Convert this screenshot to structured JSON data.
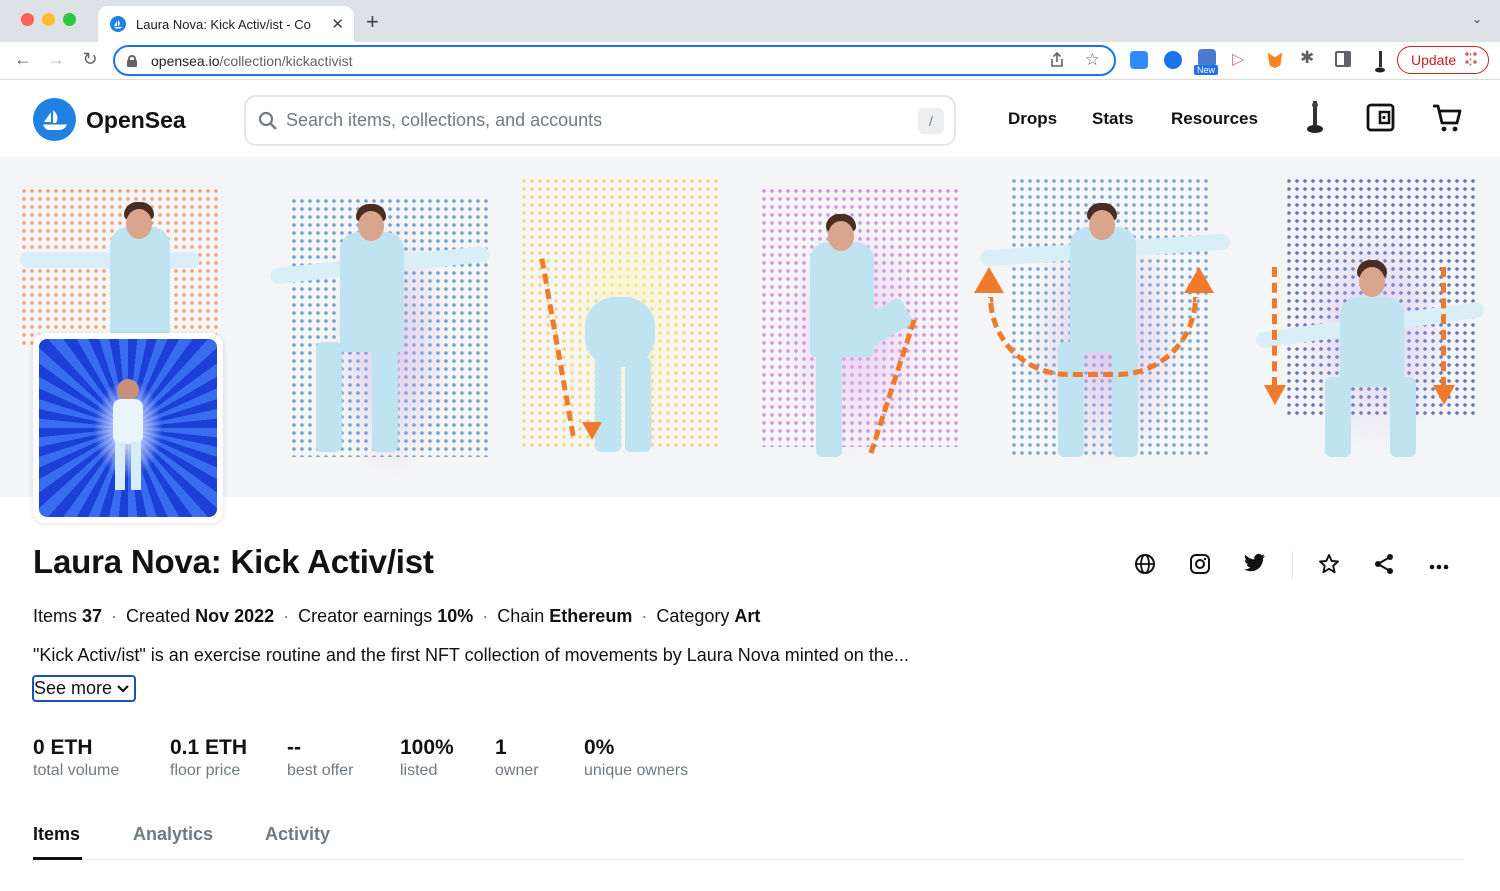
{
  "browser": {
    "tab_title": "Laura Nova: Kick Activ/ist - Co",
    "url_host": "opensea.io",
    "url_path": "/collection/kickactivist",
    "ext_new_badge": "New",
    "update_label": "Update"
  },
  "header": {
    "logo_text": "OpenSea",
    "search_placeholder": "Search items, collections, and accounts",
    "search_shortcut": "/",
    "nav": [
      "Drops",
      "Stats",
      "Resources"
    ]
  },
  "collection": {
    "title": "Laura Nova: Kick Activ/ist",
    "meta": {
      "items_label": "Items",
      "items_value": "37",
      "created_label": "Created",
      "created_value": "Nov 2022",
      "earnings_label": "Creator earnings",
      "earnings_value": "10%",
      "chain_label": "Chain",
      "chain_value": "Ethereum",
      "category_label": "Category",
      "category_value": "Art"
    },
    "description": "\"Kick Activ/ist\" is an exercise routine and the first NFT collection of movements by Laura Nova minted on the...",
    "see_more": "See more",
    "stats": [
      {
        "value": "0 ETH",
        "label": "total volume"
      },
      {
        "value": "0.1 ETH",
        "label": "floor price"
      },
      {
        "value": "--",
        "label": "best offer"
      },
      {
        "value": "100%",
        "label": "listed"
      },
      {
        "value": "1",
        "label": "owner"
      },
      {
        "value": "0%",
        "label": "unique owners"
      }
    ],
    "tabs": [
      "Items",
      "Analytics",
      "Activity"
    ]
  },
  "colors": {
    "brand": "#2081e2",
    "text": "#121212",
    "muted": "#707a83",
    "accent_orange": "#f07a2c"
  }
}
